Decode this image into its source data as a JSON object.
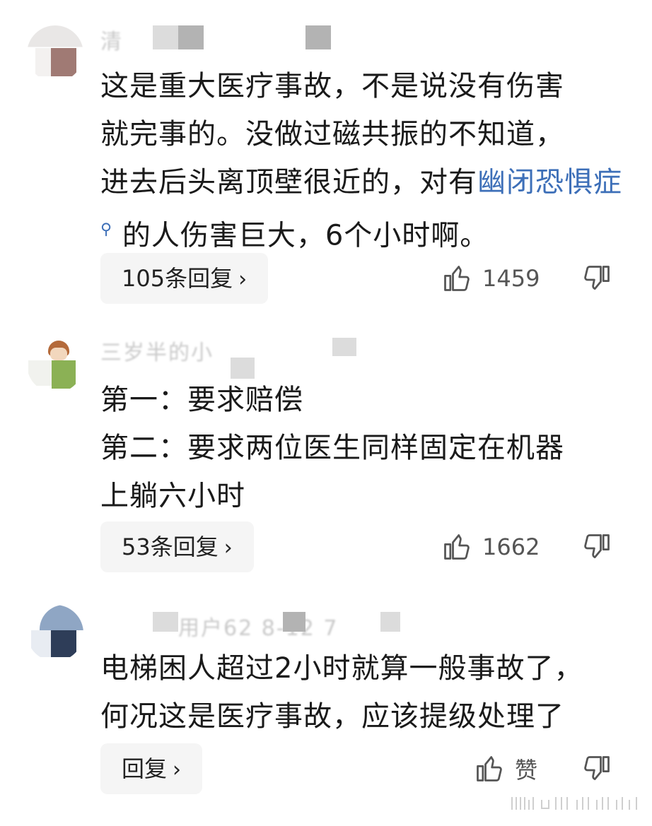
{
  "comments": [
    {
      "lines": [
        "这是重大医疗事故，不是说没有伤害",
        "就完事的。没做过磁共振的不知道，",
        "进去后头离顶壁很近的，对有"
      ],
      "link": "幽闭恐惧症",
      "link_after": " 的人伤害巨大，6个小时啊。",
      "reply_label": "105条回复",
      "likes": "1459"
    },
    {
      "lines": [
        "第一：要求赔偿",
        "第二：要求两位医生同样固定在机器",
        "上躺六小时"
      ],
      "reply_label": "53条回复",
      "likes": "1662"
    },
    {
      "lines": [
        "电梯困人超过2小时就算一般事故了，",
        "何况这是医疗事故，应该提级处理了"
      ],
      "reply_label": "回复",
      "likes": "赞"
    }
  ],
  "icons": [
    "thumbs-up-icon",
    "thumbs-down-icon",
    "chevron-right-icon",
    "search-icon"
  ],
  "colors": {
    "link": "#3d6fb8",
    "text": "#1a1a1a",
    "button_bg": "#f5f5f5",
    "meta": "#555555"
  }
}
